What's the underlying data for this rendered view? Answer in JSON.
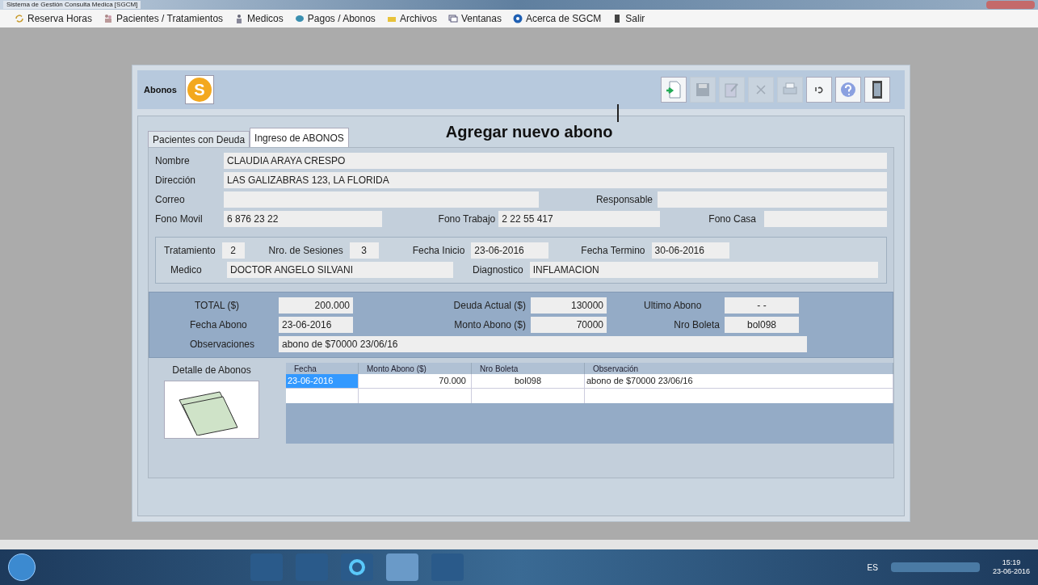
{
  "window": {
    "title": "Sistema de Gestión Consulta Medica [SGCM]"
  },
  "menu": [
    {
      "label": "Reserva Horas"
    },
    {
      "label": "Pacientes / Tratamientos"
    },
    {
      "label": "Medicos"
    },
    {
      "label": "Pagos / Abonos"
    },
    {
      "label": "Archivos"
    },
    {
      "label": "Ventanas"
    },
    {
      "label": "Acerca de SGCM"
    },
    {
      "label": "Salir"
    }
  ],
  "form": {
    "title": "Abonos",
    "badge": "S",
    "toolbar": [
      {
        "disabled": false
      },
      {
        "disabled": true
      },
      {
        "disabled": true
      },
      {
        "disabled": true
      },
      {
        "disabled": true
      },
      {
        "disabled": false
      },
      {
        "disabled": false
      },
      {
        "disabled": false
      }
    ],
    "callout": "Agregar nuevo abono",
    "tabs": [
      {
        "label": "Pacientes con Deuda",
        "selected": false
      },
      {
        "label": "Ingreso de ABONOS",
        "selected": true
      }
    ],
    "patient": {
      "nombre": {
        "label": "Nombre",
        "value": "CLAUDIA ARAYA CRESPO"
      },
      "direccion": {
        "label": "Dirección",
        "value": "LAS GALIZABRAS 123, LA FLORIDA"
      },
      "correo": {
        "label": "Correo"
      },
      "responsable": {
        "label": "Responsable"
      },
      "fono_movil": {
        "label": "Fono Movil",
        "value": "6 876 23 22"
      },
      "fono_trabajo": {
        "label": "Fono Trabajo",
        "value": "2 22 55 417"
      },
      "fono_casa": {
        "label": "Fono Casa"
      }
    },
    "treatment": {
      "tratamiento": {
        "label": "Tratamiento",
        "value": "2"
      },
      "sesiones": {
        "label": "Nro. de Sesiones",
        "value": "3"
      },
      "fecha_inicio": {
        "label": "Fecha Inicio",
        "value": "23-06-2016"
      },
      "fecha_termino": {
        "label": "Fecha Termino",
        "value": "30-06-2016"
      },
      "medico": {
        "label": "Medico",
        "value": "DOCTOR ANGELO SILVANI"
      },
      "diagnostico": {
        "label": "Diagnostico",
        "value": "INFLAMACION"
      }
    },
    "payment": {
      "total": {
        "label": "TOTAL  ($)",
        "value": "200.000"
      },
      "deuda": {
        "label": "Deuda Actual ($)",
        "value": "130000"
      },
      "ultimo": {
        "label": "Ultimo Abono",
        "value": "- -"
      },
      "fecha": {
        "label": "Fecha Abono",
        "value": "23-06-2016"
      },
      "monto": {
        "label": "Monto Abono ($)",
        "value": "70000"
      },
      "boleta": {
        "label": "Nro Boleta",
        "value": "bol098"
      },
      "obs": {
        "label": "Observaciones",
        "value": "abono de $70000 23/06/16"
      }
    },
    "detail": {
      "label": "Detalle de Abonos",
      "table": {
        "columns": [
          "Fecha",
          "Monto Abono ($)",
          "Nro Boleta",
          "Observación"
        ],
        "rows": [
          {
            "cells": [
              "23-06-2016",
              "70.000",
              "bol098",
              "abono de $70000 23/06/16"
            ],
            "selected": true
          }
        ]
      }
    }
  },
  "taskbar": {
    "language": "ES",
    "time": "15:19",
    "date": "23-06-2016"
  }
}
